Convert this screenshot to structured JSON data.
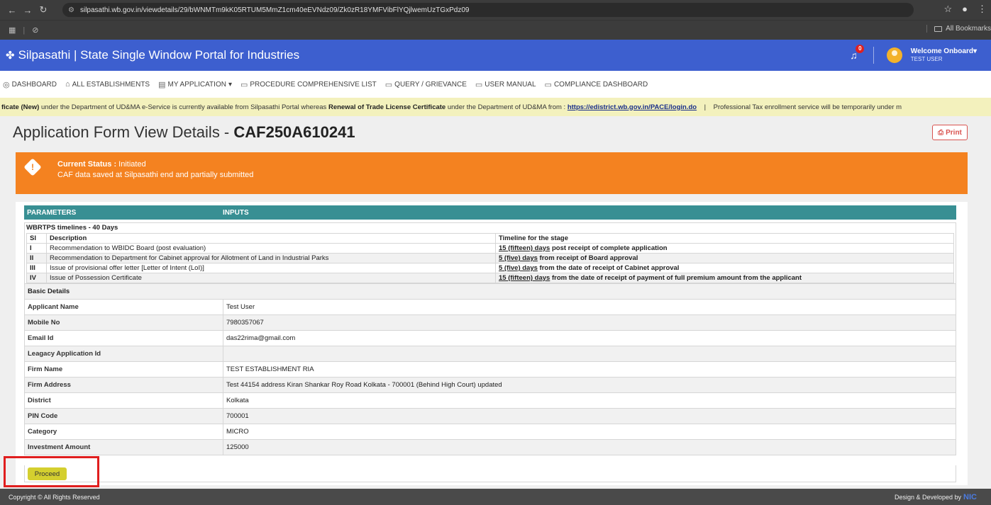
{
  "browser": {
    "url": "silpasathi.wb.gov.in/viewdetails/29/bWNMTm9kK05RTUM5MmZ1cm40eEVNdz09/Zk0zR18YMFVibFlYQjlwemUzTGxPdz09",
    "all_bookmarks": "All Bookmarks"
  },
  "header": {
    "app_title": "Silpasathi | State Single Window Portal for Industries",
    "notification_count": "0",
    "welcome": "Welcome Onboard",
    "user_name": "TEST USER"
  },
  "menu": [
    {
      "label": "DASHBOARD",
      "icon": "dashboard-icon",
      "glyph": "◎"
    },
    {
      "label": "ALL ESTABLISHMENTS",
      "icon": "building-icon",
      "glyph": "⌂"
    },
    {
      "label": "MY APPLICATION",
      "icon": "document-icon",
      "glyph": "▤",
      "dropdown": true
    },
    {
      "label": "PROCEDURE COMPREHENSIVE LIST",
      "icon": "list-icon",
      "glyph": "▭"
    },
    {
      "label": "QUERY / GRIEVANCE",
      "icon": "list-icon",
      "glyph": "▭"
    },
    {
      "label": "USER MANUAL",
      "icon": "list-icon",
      "glyph": "▭"
    },
    {
      "label": "COMPLIANCE DASHBOARD",
      "icon": "list-icon",
      "glyph": "▭"
    }
  ],
  "marquee": {
    "part1_bold": "ficate (New)",
    "part2": " under the Department of UD&MA e-Service is currently available from Silpasathi Portal whereas ",
    "part3_bold": "Renewal of Trade License Certificate",
    "part4": " under the Department of UD&MA from : ",
    "link": "https://edistrict.wb.gov.in/PACE/login.do",
    "part5": "    |    Professional Tax enrollment service will be temporarily under m"
  },
  "page": {
    "title_prefix": "Application Form View Details - ",
    "caf_id": "CAF250A610241",
    "print_label": "Print"
  },
  "status": {
    "label": "Current Status :",
    "value": " Initiated",
    "message": "CAF data saved at Silpasathi end and partially submitted"
  },
  "params_header": {
    "col1": "PARAMETERS",
    "col2": "INPUTS"
  },
  "timeline": {
    "title": "WBRTPS timelines - 40 Days",
    "head_si": "Sl",
    "head_desc": "Description",
    "head_stage": "Timeline for the stage",
    "rows": [
      {
        "si": "I",
        "desc": "Recommendation to WBIDC Board (post evaluation)",
        "days": "15 (fifteen) days",
        "rest": " post receipt of complete application"
      },
      {
        "si": "II",
        "desc": "Recommendation to Department for Cabinet approval for Allotment of Land in Industrial Parks",
        "days": "5 (five) days",
        "rest": " from receipt of Board approval"
      },
      {
        "si": "III",
        "desc": "Issue of provisional offer letter [Letter of Intent (LoI)]",
        "days": "5 (five) days",
        "rest": " from the date of receipt of Cabinet approval"
      },
      {
        "si": "IV",
        "desc": "Issue of Possession Certificate",
        "days": "15 (fifteen) days",
        "rest": " from the date of receipt of payment of full premium amount from the applicant"
      }
    ]
  },
  "basic_details": {
    "title": "Basic Details",
    "rows": [
      {
        "label": "Applicant Name",
        "value": "Test User"
      },
      {
        "label": "Mobile No",
        "value": "7980357067"
      },
      {
        "label": "Email Id",
        "value": "das22rima@gmail.com"
      },
      {
        "label": "Leagacy Application Id",
        "value": ""
      },
      {
        "label": "Firm Name",
        "value": "TEST ESTABLISHMENT RIA"
      },
      {
        "label": "Firm Address",
        "value": "Test 44154 address Kiran Shankar Roy Road Kolkata - 700001 (Behind High Court) updated"
      },
      {
        "label": "District",
        "value": "Kolkata"
      },
      {
        "label": "PIN Code",
        "value": "700001"
      },
      {
        "label": "Category",
        "value": "MICRO"
      },
      {
        "label": "Investment Amount",
        "value": "125000"
      }
    ]
  },
  "proceed_label": "Proceed",
  "footer": {
    "copyright": "Copyright © All Rights Reserved",
    "developed_by": "Design & Developed by",
    "nic": "NIC"
  }
}
